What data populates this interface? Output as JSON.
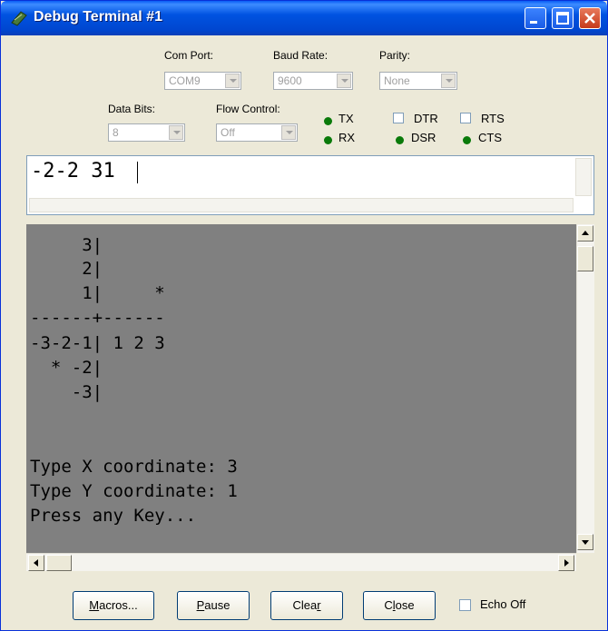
{
  "window": {
    "title": "Debug Terminal #1"
  },
  "settings": {
    "com_port": {
      "label": "Com Port:",
      "value": "COM9"
    },
    "baud_rate": {
      "label": "Baud Rate:",
      "value": "9600"
    },
    "parity": {
      "label": "Parity:",
      "value": "None"
    },
    "data_bits": {
      "label": "Data Bits:",
      "value": "8"
    },
    "flow_control": {
      "label": "Flow Control:",
      "value": "Off"
    }
  },
  "signals": {
    "tx": "TX",
    "rx": "RX",
    "dtr": "DTR",
    "rts": "RTS",
    "dsr": "DSR",
    "cts": "CTS",
    "led_color": "#0a7a0a"
  },
  "input": {
    "value": "-2-2 31"
  },
  "terminal": {
    "lines": [
      "     3|",
      "     2|",
      "     1|     *",
      "------+------",
      "-3-2-1| 1 2 3",
      "  * -2|",
      "    -3|",
      "",
      "",
      "Type X coordinate: 3",
      "Type Y coordinate: 1",
      "Press any Key..."
    ],
    "background": "#808080"
  },
  "buttons": {
    "macros": {
      "ul": "M",
      "rest": "acros..."
    },
    "pause": {
      "ul": "P",
      "rest": "ause"
    },
    "clear": {
      "pre": "Clea",
      "ul": "r"
    },
    "close": {
      "pre": "C",
      "ul": "l",
      "rest": "ose"
    },
    "echo_off": "Echo Off"
  }
}
